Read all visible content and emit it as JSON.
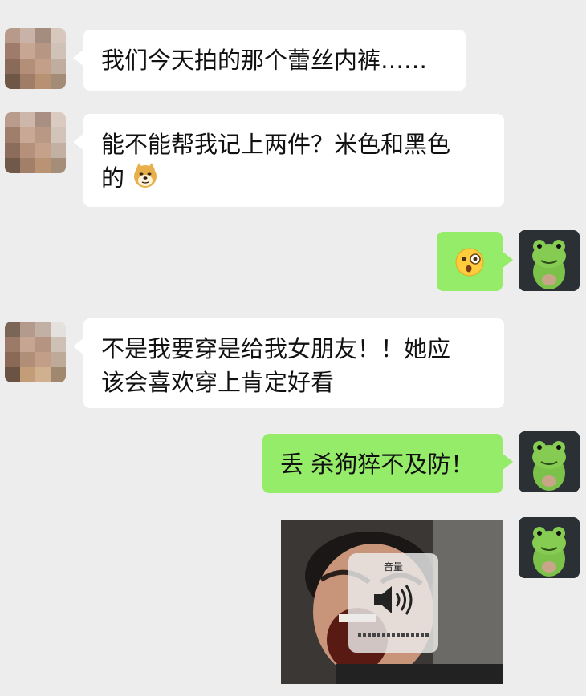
{
  "messages": [
    {
      "side": "left",
      "text": "我们今天拍的那个蕾丝内裤……"
    },
    {
      "side": "left",
      "line1": "能不能帮我记上两件？米色和黑色",
      "line2": "的",
      "emoji": "doge-emoji"
    },
    {
      "side": "right",
      "emoji": "surprised-monocle-emoji"
    },
    {
      "side": "left",
      "line1": "不是我要穿是给我女朋友！！她应",
      "line2": "该会喜欢穿上肯定好看"
    },
    {
      "side": "right",
      "text": "丢 杀狗猝不及防！"
    },
    {
      "side": "right",
      "image": "meme-screaming-man",
      "hud_title": "音量"
    }
  ],
  "colors": {
    "background": "#ededed",
    "sent_bubble": "#95ec69",
    "received_bubble": "#ffffff"
  }
}
